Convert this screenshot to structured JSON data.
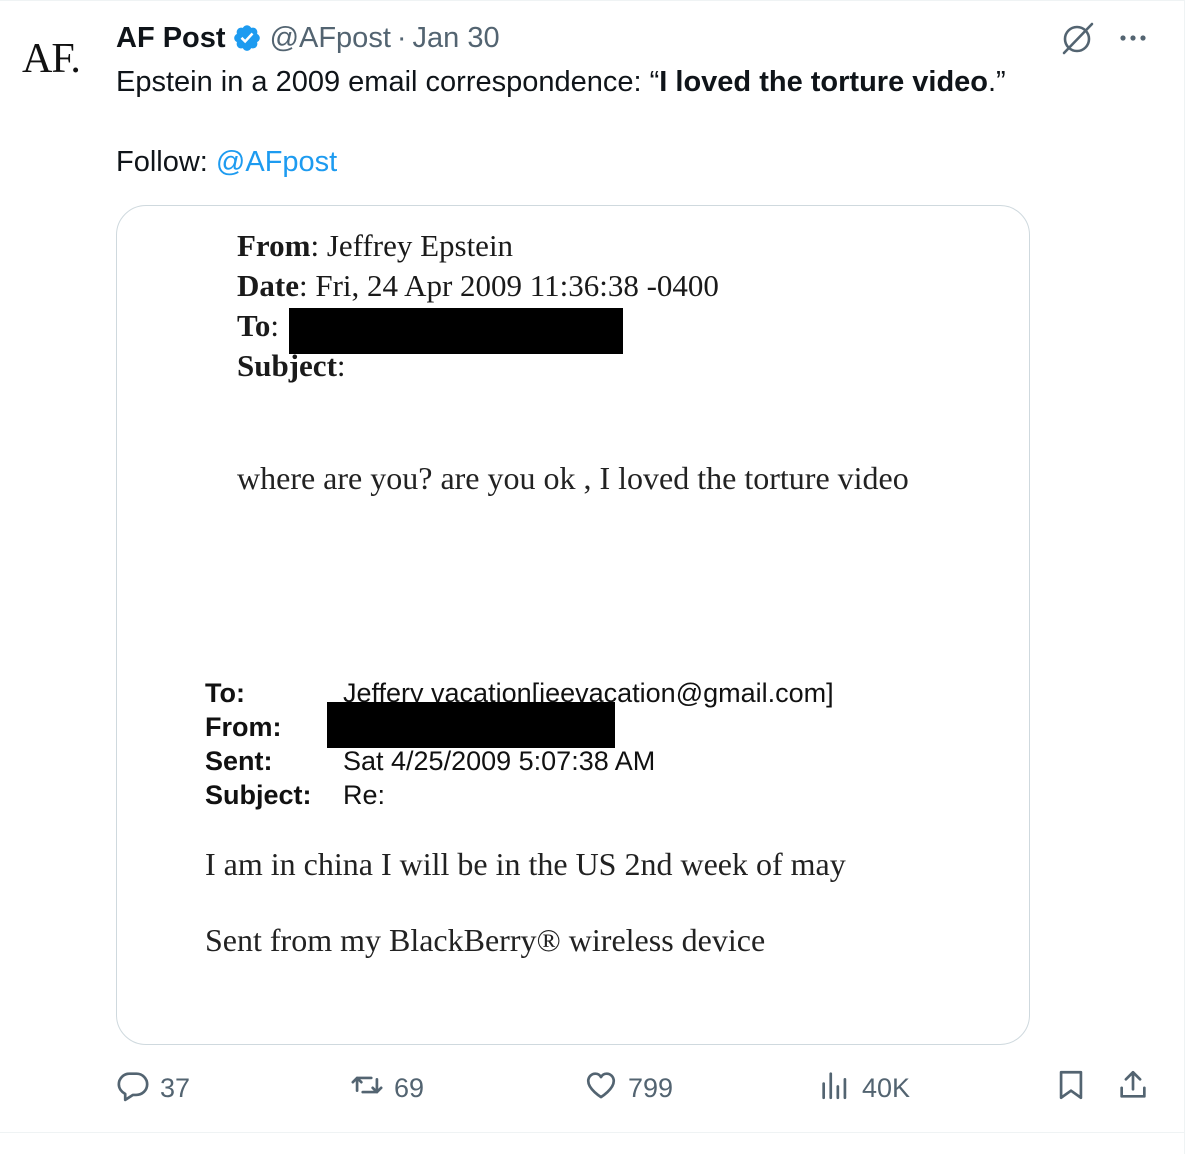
{
  "author": {
    "avatar_text": "AF.",
    "display_name": "AF Post",
    "handle": "@AFpost",
    "separator": "·",
    "date": "Jan 30"
  },
  "tweet": {
    "line1_prefix": "Epstein in a 2009 email correspondence: “",
    "line1_bold": "I loved the torture video",
    "line1_suffix": ".”",
    "follow_label": "Follow: ",
    "follow_mention": "@AFpost"
  },
  "document": {
    "email1": {
      "from_label": "From",
      "from_value": ": Jeffrey Epstein",
      "date_label": "Date",
      "date_value": ": Fri, 24 Apr 2009 11:36:38 -0400",
      "to_label": "To",
      "to_value": ":",
      "subject_label": "Subject",
      "subject_value": ":",
      "body": "where are you? are you ok , I loved the torture video"
    },
    "email2": {
      "to_label": "To:",
      "to_value": "Jeffery vacation[jeevacation@gmail.com]",
      "from_label": "From:",
      "from_value": "",
      "sent_label": "Sent:",
      "sent_value": "Sat 4/25/2009 5:07:38 AM",
      "subject_label": "Subject:",
      "subject_value": "Re:",
      "body": "I am in china I will be in the US 2nd week of may",
      "signature": "Sent from my BlackBerry® wireless device"
    }
  },
  "actions": {
    "replies": "37",
    "reposts": "69",
    "likes": "799",
    "views": "40K"
  },
  "icons": {
    "verified": "verified-badge-icon",
    "grok": "grok-icon",
    "more": "more-icon",
    "reply": "reply-icon",
    "repost": "repost-icon",
    "like": "like-icon",
    "views": "views-icon",
    "bookmark": "bookmark-icon",
    "share": "share-icon"
  },
  "colors": {
    "link": "#1d9bf0",
    "secondary_text": "#536471",
    "border": "#cfd9de"
  }
}
